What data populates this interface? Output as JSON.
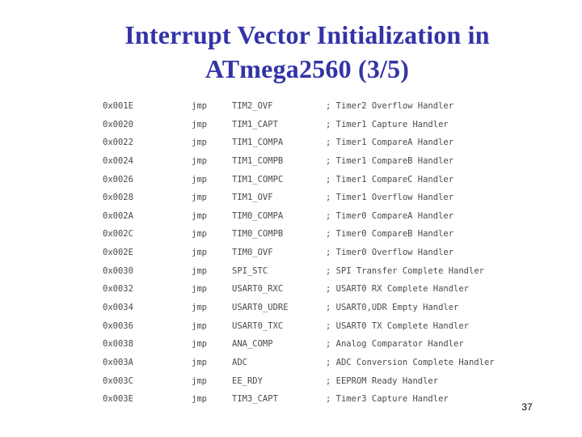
{
  "slide": {
    "title_line1": "Interrupt Vector Initialization in",
    "title_line2": "ATmega2560 (3/5)",
    "page_number": "37"
  },
  "code": {
    "rows": [
      {
        "address": "0x001E",
        "op": "jmp",
        "label": "TIM2_OVF",
        "comment": "; Timer2 Overflow Handler"
      },
      {
        "address": "0x0020",
        "op": "jmp",
        "label": "TIM1_CAPT",
        "comment": "; Timer1 Capture Handler"
      },
      {
        "address": "0x0022",
        "op": "jmp",
        "label": "TIM1_COMPA",
        "comment": "; Timer1 CompareA Handler"
      },
      {
        "address": "0x0024",
        "op": "jmp",
        "label": "TIM1_COMPB",
        "comment": "; Timer1 CompareB Handler"
      },
      {
        "address": "0x0026",
        "op": "jmp",
        "label": "TIM1_COMPC",
        "comment": "; Timer1 CompareC Handler"
      },
      {
        "address": "0x0028",
        "op": "jmp",
        "label": "TIM1_OVF",
        "comment": "; Timer1 Overflow Handler"
      },
      {
        "address": "0x002A",
        "op": "jmp",
        "label": "TIM0_COMPA",
        "comment": "; Timer0 CompareA Handler"
      },
      {
        "address": "0x002C",
        "op": "jmp",
        "label": "TIM0_COMPB",
        "comment": "; Timer0 CompareB Handler"
      },
      {
        "address": "0x002E",
        "op": "jmp",
        "label": "TIM0_OVF",
        "comment": "; Timer0 Overflow Handler"
      },
      {
        "address": "0x0030",
        "op": "jmp",
        "label": "SPI_STC",
        "comment": "; SPI Transfer Complete Handler"
      },
      {
        "address": "0x0032",
        "op": "jmp",
        "label": "USART0_RXC",
        "comment": "; USART0 RX Complete Handler"
      },
      {
        "address": "0x0034",
        "op": "jmp",
        "label": "USART0_UDRE",
        "comment": "; USART0,UDR Empty Handler"
      },
      {
        "address": "0x0036",
        "op": "jmp",
        "label": "USART0_TXC",
        "comment": "; USART0 TX Complete Handler"
      },
      {
        "address": "0x0038",
        "op": "jmp",
        "label": "ANA_COMP",
        "comment": "; Analog Comparator Handler"
      },
      {
        "address": "0x003A",
        "op": "jmp",
        "label": "ADC",
        "comment": "; ADC Conversion Complete Handler"
      },
      {
        "address": "0x003C",
        "op": "jmp",
        "label": "EE_RDY",
        "comment": "; EEPROM Ready Handler"
      },
      {
        "address": "0x003E",
        "op": "jmp",
        "label": "TIM3_CAPT",
        "comment": "; Timer3 Capture Handler"
      }
    ]
  }
}
